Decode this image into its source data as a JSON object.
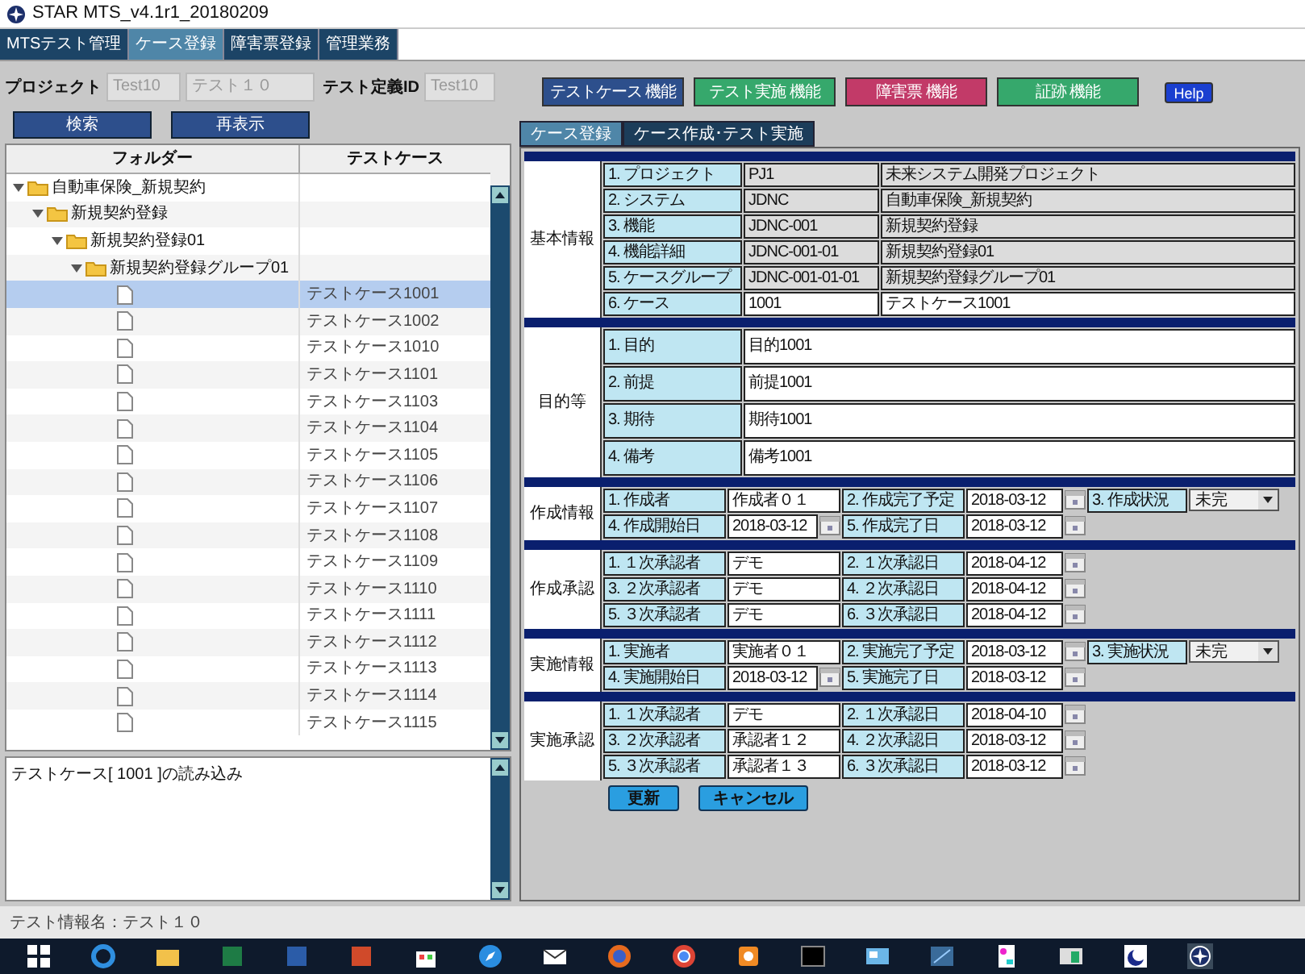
{
  "window": {
    "title": "STAR MTS_v4.1r1_20180209"
  },
  "menu_tabs": [
    {
      "label": "MTSテスト管理",
      "selected": false
    },
    {
      "label": "ケース登録",
      "selected": true
    },
    {
      "label": "障害票登録",
      "selected": false
    },
    {
      "label": "管理業務",
      "selected": false
    }
  ],
  "search_bar": {
    "project_label": "プロジェクト",
    "project_code": "Test10",
    "project_name": "テスト１０",
    "test_def_label": "テスト定義ID",
    "test_def_value": "Test10",
    "buttons": [
      "検索",
      "再表示"
    ]
  },
  "tree": {
    "columns": [
      "フォルダー",
      "テストケース"
    ],
    "nodes": [
      {
        "label": "自動車保険_新規契約",
        "expanded": true,
        "children": [
          {
            "label": "新規契約登録",
            "expanded": true,
            "children": [
              {
                "label": "新規契約登録01",
                "expanded": true,
                "children": [
                  {
                    "label": "新規契約登録グループ01",
                    "expanded": true,
                    "children": [
                      {
                        "case": "テストケース1001",
                        "selected": true
                      },
                      {
                        "case": "テストケース1002",
                        "selected": false
                      },
                      {
                        "case": "テストケース1010",
                        "selected": false
                      },
                      {
                        "case": "テストケース1101",
                        "selected": false
                      },
                      {
                        "case": "テストケース1103",
                        "selected": false
                      },
                      {
                        "case": "テストケース1104",
                        "selected": false
                      },
                      {
                        "case": "テストケース1105",
                        "selected": false
                      },
                      {
                        "case": "テストケース1106",
                        "selected": false
                      },
                      {
                        "case": "テストケース1107",
                        "selected": false
                      },
                      {
                        "case": "テストケース1108",
                        "selected": false
                      },
                      {
                        "case": "テストケース1109",
                        "selected": false
                      },
                      {
                        "case": "テストケース1110",
                        "selected": false
                      },
                      {
                        "case": "テストケース1111",
                        "selected": false
                      },
                      {
                        "case": "テストケース1112",
                        "selected": false
                      },
                      {
                        "case": "テストケース1113",
                        "selected": false
                      },
                      {
                        "case": "テストケース1114",
                        "selected": false
                      },
                      {
                        "case": "テストケース1115",
                        "selected": false
                      }
                    ]
                  }
                ]
              }
            ]
          }
        ]
      }
    ]
  },
  "log": {
    "text": "テストケース[ 1001 ]の読み込み"
  },
  "function_buttons": [
    {
      "label": "テストケース 機能",
      "color": "#2d4f8c"
    },
    {
      "label": "テスト実施 機能",
      "color": "#36a86c"
    },
    {
      "label": "障害票 機能",
      "color": "#c23a68"
    },
    {
      "label": "証跡 機能",
      "color": "#36a86c"
    },
    {
      "label": "Help",
      "color": "#1a3fd0"
    }
  ],
  "panel_tabs": [
    {
      "label": "ケース登録",
      "selected": true
    },
    {
      "label": "ケース作成･テスト実施",
      "selected": false
    }
  ],
  "sections": [
    {
      "label": "基本情報",
      "kind": "basic",
      "rows": [
        {
          "cells": [
            {
              "kind": "label",
              "text": "1. プロジェクト"
            },
            {
              "kind": "readonly",
              "text": "PJ1"
            },
            {
              "kind": "readonly",
              "text": "未来システム開発プロジェクト"
            }
          ]
        },
        {
          "cells": [
            {
              "kind": "label",
              "text": "2. システム"
            },
            {
              "kind": "readonly",
              "text": "JDNC"
            },
            {
              "kind": "readonly",
              "text": "自動車保険_新規契約"
            }
          ]
        },
        {
          "cells": [
            {
              "kind": "label",
              "text": "3. 機能"
            },
            {
              "kind": "readonly",
              "text": "JDNC-001"
            },
            {
              "kind": "readonly",
              "text": "新規契約登録"
            }
          ]
        },
        {
          "cells": [
            {
              "kind": "label",
              "text": "4. 機能詳細"
            },
            {
              "kind": "readonly",
              "text": "JDNC-001-01"
            },
            {
              "kind": "readonly",
              "text": "新規契約登録01"
            }
          ]
        },
        {
          "cells": [
            {
              "kind": "label",
              "text": "5. ケースグループ"
            },
            {
              "kind": "readonly",
              "text": "JDNC-001-01-01"
            },
            {
              "kind": "readonly",
              "text": "新規契約登録グループ01"
            }
          ]
        },
        {
          "cells": [
            {
              "kind": "label",
              "text": "6. ケース"
            },
            {
              "kind": "text",
              "text": "1001"
            },
            {
              "kind": "text",
              "text": "テストケース1001"
            }
          ]
        }
      ]
    },
    {
      "label": "目的等",
      "kind": "memo",
      "rows": [
        {
          "cells": [
            {
              "kind": "label",
              "text": "1. 目的"
            },
            {
              "kind": "text",
              "text": "目的1001"
            }
          ]
        },
        {
          "cells": [
            {
              "kind": "label",
              "text": "2. 前提"
            },
            {
              "kind": "text",
              "text": "前提1001"
            }
          ]
        },
        {
          "cells": [
            {
              "kind": "label",
              "text": "3. 期待"
            },
            {
              "kind": "text",
              "text": "期待1001"
            }
          ]
        },
        {
          "cells": [
            {
              "kind": "label",
              "text": "4. 備考"
            },
            {
              "kind": "text",
              "text": "備考1001"
            }
          ]
        }
      ]
    },
    {
      "label": "作成情報",
      "kind": "grid",
      "rows": [
        {
          "cells": [
            {
              "kind": "label",
              "text": "1. 作成者"
            },
            {
              "kind": "text",
              "text": "作成者０１"
            },
            {
              "kind": "label",
              "text": "2. 作成完了予定"
            },
            {
              "kind": "date",
              "text": "2018-03-12"
            },
            {
              "kind": "label",
              "text": "3. 作成状況"
            },
            {
              "kind": "select",
              "text": "未完"
            }
          ]
        },
        {
          "cells": [
            {
              "kind": "label",
              "text": "4. 作成開始日"
            },
            {
              "kind": "date",
              "text": "2018-03-12"
            },
            {
              "kind": "label",
              "text": "5. 作成完了日"
            },
            {
              "kind": "date",
              "text": "2018-03-12"
            }
          ]
        }
      ]
    },
    {
      "label": "作成承認",
      "kind": "grid",
      "rows": [
        {
          "cells": [
            {
              "kind": "label",
              "text": "1. １次承認者"
            },
            {
              "kind": "text",
              "text": "デモ"
            },
            {
              "kind": "label",
              "text": "2. １次承認日"
            },
            {
              "kind": "date",
              "text": "2018-04-12"
            }
          ]
        },
        {
          "cells": [
            {
              "kind": "label",
              "text": "3. ２次承認者"
            },
            {
              "kind": "text",
              "text": "デモ"
            },
            {
              "kind": "label",
              "text": "4. ２次承認日"
            },
            {
              "kind": "date",
              "text": "2018-04-12"
            }
          ]
        },
        {
          "cells": [
            {
              "kind": "label",
              "text": "5. ３次承認者"
            },
            {
              "kind": "text",
              "text": "デモ"
            },
            {
              "kind": "label",
              "text": "6. ３次承認日"
            },
            {
              "kind": "date",
              "text": "2018-04-12"
            }
          ]
        }
      ]
    },
    {
      "label": "実施情報",
      "kind": "grid",
      "rows": [
        {
          "cells": [
            {
              "kind": "label",
              "text": "1. 実施者"
            },
            {
              "kind": "text",
              "text": "実施者０１"
            },
            {
              "kind": "label",
              "text": "2. 実施完了予定"
            },
            {
              "kind": "date",
              "text": "2018-03-12"
            },
            {
              "kind": "label",
              "text": "3. 実施状況"
            },
            {
              "kind": "select",
              "text": "未完"
            }
          ]
        },
        {
          "cells": [
            {
              "kind": "label",
              "text": "4. 実施開始日"
            },
            {
              "kind": "date",
              "text": "2018-03-12"
            },
            {
              "kind": "label",
              "text": "5. 実施完了日"
            },
            {
              "kind": "date",
              "text": "2018-03-12"
            }
          ]
        }
      ]
    },
    {
      "label": "実施承認",
      "kind": "grid",
      "rows": [
        {
          "cells": [
            {
              "kind": "label",
              "text": "1. １次承認者"
            },
            {
              "kind": "text",
              "text": "デモ"
            },
            {
              "kind": "label",
              "text": "2. １次承認日"
            },
            {
              "kind": "date",
              "text": "2018-04-10"
            }
          ]
        },
        {
          "cells": [
            {
              "kind": "label",
              "text": "3. ２次承認者"
            },
            {
              "kind": "text",
              "text": "承認者１２"
            },
            {
              "kind": "label",
              "text": "4. ２次承認日"
            },
            {
              "kind": "date",
              "text": "2018-03-12"
            }
          ]
        },
        {
          "cells": [
            {
              "kind": "label",
              "text": "5. ３次承認者"
            },
            {
              "kind": "text",
              "text": "承認者１３"
            },
            {
              "kind": "label",
              "text": "6. ３次承認日"
            },
            {
              "kind": "date",
              "text": "2018-03-12"
            }
          ]
        }
      ]
    }
  ],
  "form_buttons": [
    "更新",
    "キャンセル"
  ],
  "status_bar": {
    "text": "テスト情報名：テスト１０"
  }
}
